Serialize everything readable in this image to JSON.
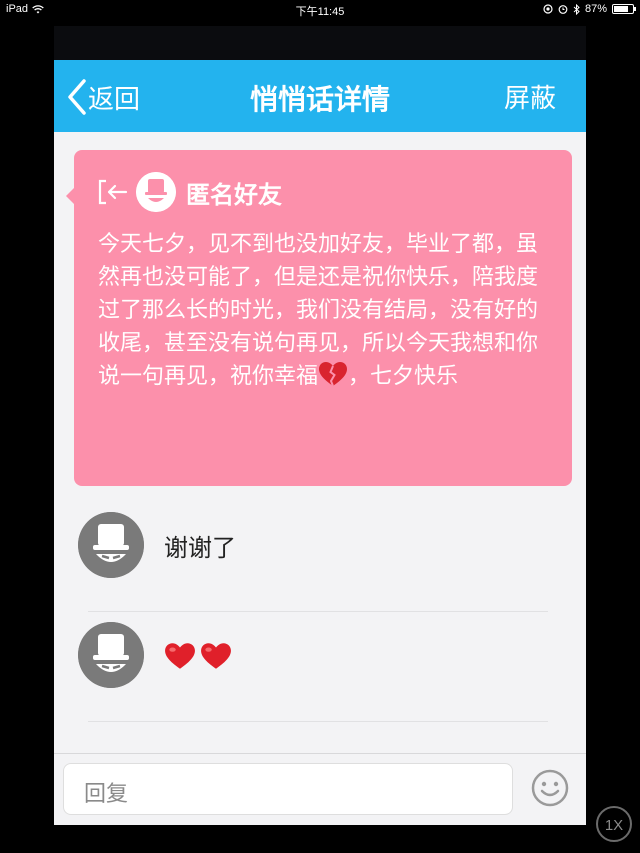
{
  "status_bar": {
    "device": "iPad",
    "time": "下午11:45",
    "battery": "87%",
    "battery_level": 0.87
  },
  "navbar": {
    "back_label": "返回",
    "title": "悄悄话详情",
    "right_label": "屏蔽"
  },
  "message": {
    "sender": "匿名好友",
    "text_before": "今天七夕，见不到也没加好友，毕业了都，虽然再也没可能了，但是还是祝你快乐，陪我度过了那么长的时光，我们没有结局，没有好的收尾，甚至没有说句再见，所以今天我想和你说一句再见，祝你幸福",
    "inline_emoji": "broken-heart-icon",
    "text_after": "，七夕快乐"
  },
  "replies": [
    {
      "text": "谢谢了"
    },
    {
      "emoji": [
        "red-heart-icon",
        "red-heart-icon"
      ]
    }
  ],
  "input": {
    "placeholder": "回复"
  },
  "zoom_button": "1X",
  "colors": {
    "navbar": "#23b3ee",
    "card": "#fc90ab",
    "background": "#f3f3f5"
  }
}
